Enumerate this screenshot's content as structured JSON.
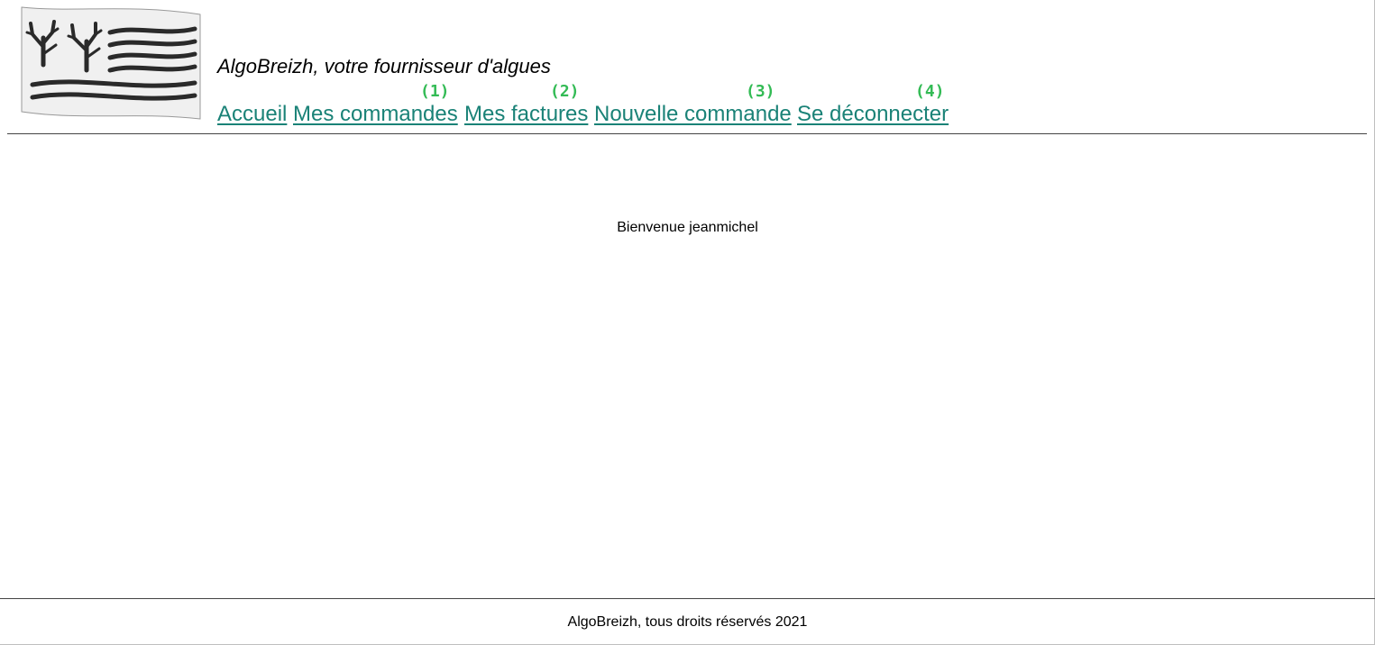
{
  "header": {
    "logo_icon": "seaweed-waves-flag-logo",
    "tagline": "AlgoBreizh, votre fournisseur d'algues"
  },
  "nav": {
    "items": [
      {
        "label": "Accueil",
        "annotation": ""
      },
      {
        "label": "Mes commandes",
        "annotation": "(1)"
      },
      {
        "label": "Mes factures",
        "annotation": "(2)"
      },
      {
        "label": "Nouvelle commande",
        "annotation": "(3)"
      },
      {
        "label": "Se déconnecter",
        "annotation": "(4)"
      }
    ]
  },
  "main": {
    "welcome": "Bienvenue jeanmichel"
  },
  "footer": {
    "copyright": "AlgoBreizh, tous droits réservés 2021"
  },
  "colors": {
    "link": "#1a8277",
    "annotation": "#33bb55"
  }
}
